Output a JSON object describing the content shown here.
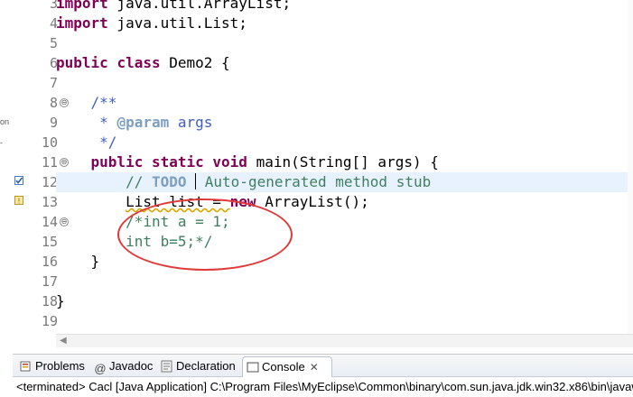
{
  "outer_strip": {
    "frag1": "on",
    "frag2": "-"
  },
  "editor": {
    "lines": [
      {
        "num": "3",
        "text": "import java.util.ArrayList;"
      },
      {
        "num": "4",
        "text": "import java.util.List;"
      },
      {
        "num": "5",
        "text": ""
      },
      {
        "num": "6",
        "text": "public class Demo2 {"
      },
      {
        "num": "7",
        "text": ""
      },
      {
        "num": "8",
        "text": "    /**"
      },
      {
        "num": "9",
        "text": "     * @param args"
      },
      {
        "num": "10",
        "text": "     */"
      },
      {
        "num": "11",
        "text": "    public static void main(String[] args) {"
      },
      {
        "num": "12",
        "text": "        // TODO Auto-generated method stub"
      },
      {
        "num": "13",
        "text": "        List list = new ArrayList();"
      },
      {
        "num": "14",
        "text": "        /*int a = 1;"
      },
      {
        "num": "15",
        "text": "        int b=5;*/"
      },
      {
        "num": "16",
        "text": "    }"
      },
      {
        "num": "17",
        "text": ""
      },
      {
        "num": "18",
        "text": "}"
      },
      {
        "num": "19",
        "text": ""
      }
    ],
    "tokens": {
      "l3_kw": "import",
      "l3_rest": " java.util.ArrayList;",
      "l4_kw": "import",
      "l4_rest": " java.util.List;",
      "l6_kw1": "public",
      "l6_sp1": " ",
      "l6_kw2": "class",
      "l6_rest": " Demo2 {",
      "l8": "    /**",
      "l9_pre": "     * ",
      "l9_tag": "@param",
      "l9_rest": " args",
      "l10": "     */",
      "l11_indent": "    ",
      "l11_kw1": "public",
      "l11_kw2": "static",
      "l11_kw3": "void",
      "l11_rest": " main(String[] args) {",
      "l12_indent": "        ",
      "l12_c1": "// ",
      "l12_todo": "TODO",
      "l12_c2": " Auto-generated method stub",
      "l13_indent": "        ",
      "l13_a": "List list = ",
      "l13_kw": "new",
      "l13_b": " ArrayList();",
      "l14_indent": "        ",
      "l14_c": "/*int a = 1;",
      "l15_indent": "        ",
      "l15_c": "int b=5;*/",
      "l16": "    }",
      "l18": "}"
    }
  },
  "panel": {
    "tabs": [
      {
        "label": "Problems",
        "icon": "problems-icon"
      },
      {
        "label": "Javadoc",
        "icon": "at-icon"
      },
      {
        "label": "Declaration",
        "icon": "declaration-icon"
      },
      {
        "label": "Console",
        "icon": "console-icon",
        "close": "✕"
      }
    ],
    "console_status": "<terminated> Cacl [Java Application] C:\\Program Files\\MyEclipse\\Common\\binary\\com.sun.java.jdk.win32.x86\\bin\\javaw.exe"
  },
  "colors": {
    "keyword": "#7f0055",
    "comment": "#3f7f5f",
    "javadoc": "#3f5fbf",
    "annotation_ellipse": "#e03a3a",
    "current_line": "#e8f2fe"
  }
}
